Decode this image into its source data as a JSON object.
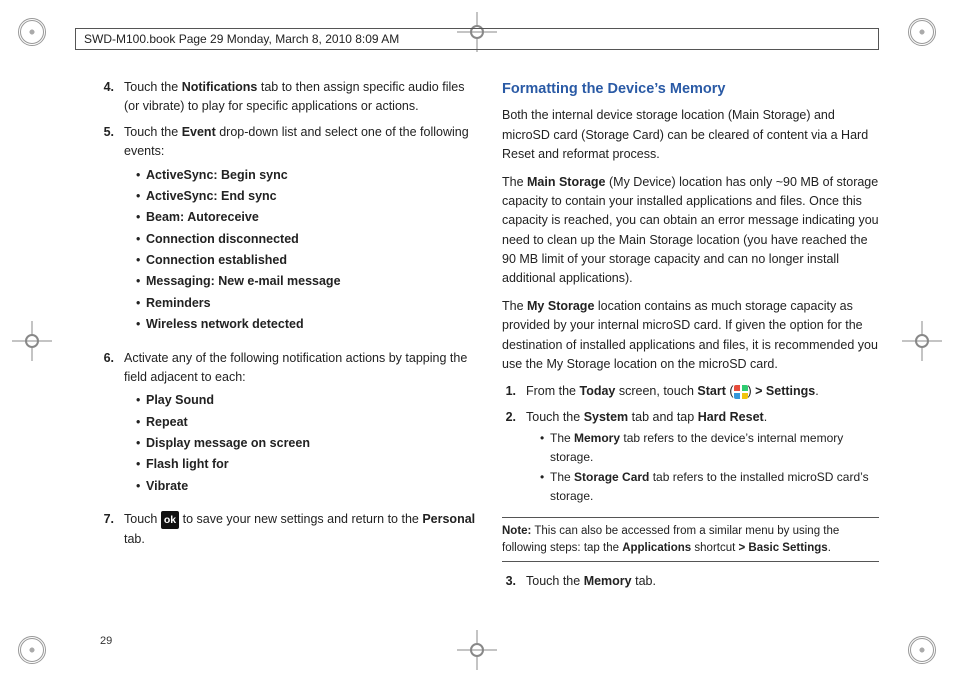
{
  "header": "SWD-M100.book  Page 29  Monday, March 8, 2010  8:09 AM",
  "pageNumber": "29",
  "left": {
    "step4": {
      "num": "4.",
      "text_before": "Touch the ",
      "bold1": "Notifications",
      "text_after": " tab to then assign specific audio files (or vibrate) to play for specific applications or actions."
    },
    "step5": {
      "num": "5.",
      "text_before": "Touch the ",
      "bold1": "Event",
      "text_after": " drop-down list and select one of the following events:",
      "bullets": [
        "ActiveSync: Begin sync",
        "ActiveSync: End sync",
        "Beam: Autoreceive",
        "Connection disconnected",
        "Connection established",
        "Messaging: New e-mail message",
        "Reminders",
        "Wireless network detected"
      ]
    },
    "step6": {
      "num": "6.",
      "text": "Activate any of the following notification actions by tapping the field adjacent to each:",
      "bullets": [
        "Play Sound",
        "Repeat",
        "Display message on screen",
        "Flash light for",
        "Vibrate"
      ]
    },
    "step7": {
      "num": "7.",
      "text_before": "Touch ",
      "ok_label": "ok",
      "text_mid": " to save your new settings and return to the ",
      "bold1": "Personal",
      "text_after": " tab."
    }
  },
  "right": {
    "heading": "Formatting the Device’s Memory",
    "para1": "Both the internal device storage location (Main Storage) and microSD card (Storage Card) can be cleared of content via a Hard Reset and reformat process.",
    "para2": {
      "pre": "The ",
      "b1": "Main Storage",
      "post": " (My Device) location has only ~90 MB of storage capacity to contain your installed applications and files. Once this capacity is reached, you can obtain an error message indicating you need to clean up the Main Storage location (you have reached the 90 MB limit of your storage capacity and can no longer install additional applications)."
    },
    "para3": {
      "pre": "The ",
      "b1": "My Storage",
      "post": " location contains as much storage capacity as provided by your internal microSD card. If given the option for the destination of installed applications and files, it is recommended you use the My Storage location on the microSD card."
    },
    "step1": {
      "num": "1.",
      "pre": "From the ",
      "b1": "Today",
      "mid1": " screen, touch ",
      "b2": "Start",
      "paren_open": " (",
      "paren_close": ") ",
      "b3": "> Settings",
      "end": "."
    },
    "step2": {
      "num": "2.",
      "pre": "Touch the ",
      "b1": "System",
      "mid": " tab and tap ",
      "b2": "Hard Reset",
      "end": ".",
      "sub1": {
        "pre": "The ",
        "b": "Memory",
        "post": " tab refers to the device’s internal memory storage."
      },
      "sub2": {
        "pre": "The ",
        "b": "Storage Card",
        "post": " tab refers to the installed microSD card’s storage."
      }
    },
    "note": {
      "label": "Note:",
      "pre": " This can also be accessed from a similar menu by using the following steps: tap the ",
      "b1": "Applications",
      "mid": " shortcut ",
      "b2": "> Basic Settings",
      "end": "."
    },
    "step3": {
      "num": "3.",
      "pre": "Touch the ",
      "b1": "Memory",
      "end": " tab."
    }
  }
}
